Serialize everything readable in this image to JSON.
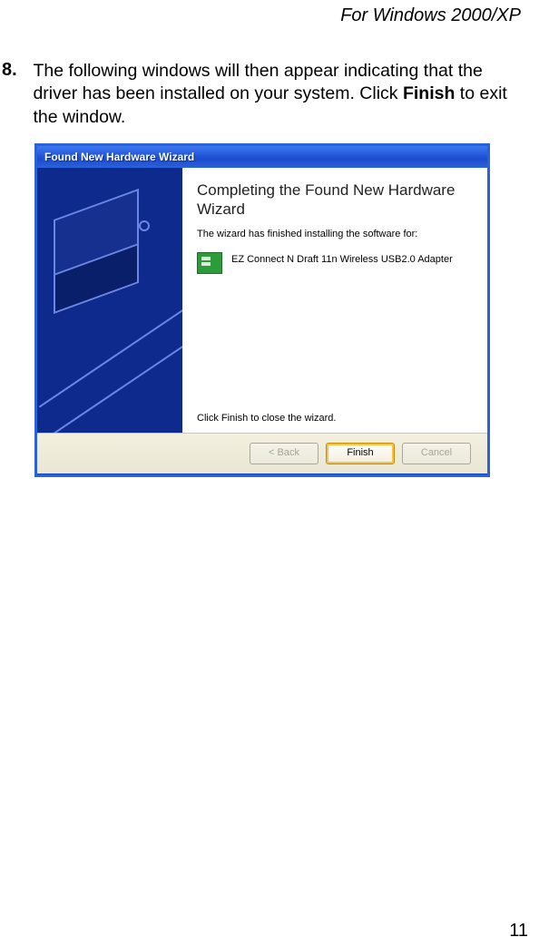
{
  "page": {
    "header": "For Windows 2000/XP",
    "page_number": "11"
  },
  "step": {
    "number": "8.",
    "text_before": "The following windows will then appear indicating that the driver has been installed on your system. Click ",
    "text_bold": "Finish",
    "text_after": " to exit the window."
  },
  "wizard": {
    "titlebar": "Found New Hardware Wizard",
    "heading": "Completing the Found New Hardware Wizard",
    "subtext": "The wizard has finished installing the software for:",
    "device_name": "EZ Connect N Draft 11n Wireless USB2.0 Adapter",
    "close_text": "Click Finish to close the wizard.",
    "buttons": {
      "back": "< Back",
      "finish": "Finish",
      "cancel": "Cancel"
    }
  }
}
